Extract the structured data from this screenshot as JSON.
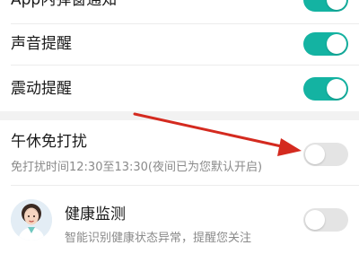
{
  "colors": {
    "accent": "#14b3a2",
    "toggle_off": "#e4e4e4",
    "arrow": "#d42a1f"
  },
  "settings": {
    "in_app_popup": {
      "label": "App内弹窗通知",
      "enabled": true
    },
    "sound": {
      "label": "声音提醒",
      "enabled": true
    },
    "vibration": {
      "label": "震动提醒",
      "enabled": true
    },
    "nap_dnd": {
      "label": "午休免打扰",
      "description": "免打扰时间12:30至13:30(夜间已为您默认开启)",
      "enabled": false
    },
    "health": {
      "label": "健康监测",
      "description": "智能识别健康状态异常，提醒您关注",
      "avatar_icon": "female-doctor-avatar-icon",
      "enabled": false
    }
  },
  "annotation": {
    "icon": "red-arrow-icon"
  }
}
